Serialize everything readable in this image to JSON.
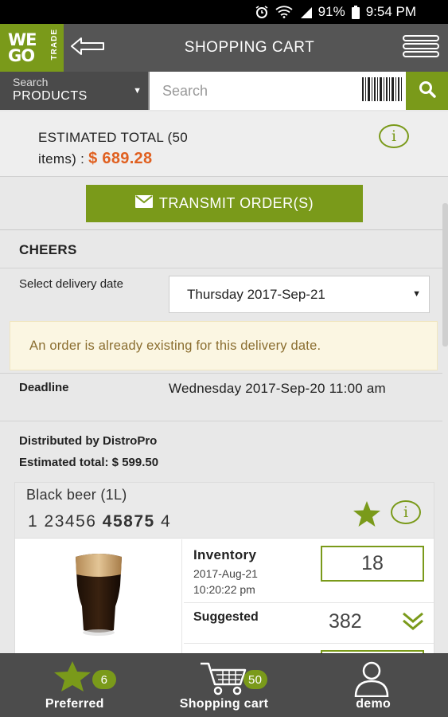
{
  "status_bar": {
    "battery": "91%",
    "time": "9:54 PM"
  },
  "header": {
    "logo_line1": "WE",
    "logo_line2": "GO",
    "logo_vertical": "TRADE",
    "title": "SHOPPING CART"
  },
  "search": {
    "scope_label": "Search",
    "scope_value": "PRODUCTS",
    "placeholder": "Search"
  },
  "estimated_total": {
    "label_line1": "ESTIMATED TOTAL (50",
    "label_line2": "items) : ",
    "amount": "$ 689.28",
    "info_icon": "i"
  },
  "transmit_button": {
    "label": "TRANSMIT ORDER(S)"
  },
  "order": {
    "customer": "CHEERS",
    "delivery_label": "Select delivery date",
    "delivery_value": "Thursday 2017-Sep-21",
    "warning": "An order is already existing for this delivery date.",
    "deadline_label": "Deadline",
    "deadline_value": "Wednesday 2017-Sep-20 11:00 am",
    "distributed_by": "Distributed by DistroPro",
    "estimated_total": "Estimated total: $ 599.50"
  },
  "product": {
    "name": "Black beer (1L)",
    "code_a": "1",
    "code_b": "23456",
    "code_c": "45875",
    "code_d": "4",
    "info_icon": "i",
    "inventory_label": "Inventory",
    "inventory_date": "2017-Aug-21",
    "inventory_time": "10:20:22 pm",
    "inventory_value": "18",
    "suggested_label": "Suggested",
    "suggested_value": "382"
  },
  "bottom_nav": {
    "preferred_label": "Preferred",
    "preferred_badge": "6",
    "cart_label": "Shopping cart",
    "cart_badge": "50",
    "user_label": "demo"
  },
  "colors": {
    "accent": "#7a9a1a",
    "amount": "#e06020",
    "header": "#555555",
    "warning_bg": "#fbf6e2"
  }
}
